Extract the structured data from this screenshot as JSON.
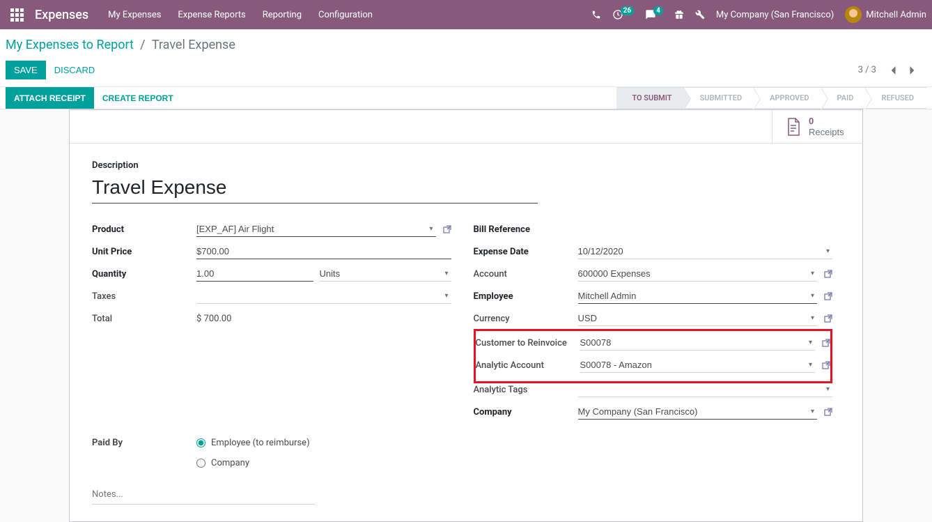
{
  "brand": {
    "app_title": "Expenses"
  },
  "nav": {
    "items": [
      "My Expenses",
      "Expense Reports",
      "Reporting",
      "Configuration"
    ]
  },
  "nav_right": {
    "activities_count": "26",
    "messages_count": "4",
    "company": "My Company (San Francisco)",
    "user": "Mitchell Admin"
  },
  "breadcrumb": {
    "parent": "My Expenses to Report",
    "current": "Travel Expense"
  },
  "actions": {
    "save": "SAVE",
    "discard": "DISCARD",
    "attach": "ATTACH RECEIPT",
    "create_report": "CREATE REPORT"
  },
  "pager": {
    "text": "3 / 3"
  },
  "status": {
    "steps": [
      "TO SUBMIT",
      "SUBMITTED",
      "APPROVED",
      "PAID",
      "REFUSED"
    ],
    "active_index": 0
  },
  "stat": {
    "count": "0",
    "label": "Receipts"
  },
  "form": {
    "description_label": "Description",
    "description_value": "Travel Expense",
    "labels": {
      "product": "Product",
      "unit_price": "Unit Price",
      "quantity": "Quantity",
      "taxes": "Taxes",
      "total": "Total",
      "bill_ref": "Bill Reference",
      "expense_date": "Expense Date",
      "account": "Account",
      "employee": "Employee",
      "currency": "Currency",
      "customer_reinvoice": "Customer to Reinvoice",
      "analytic_account": "Analytic Account",
      "analytic_tags": "Analytic Tags",
      "company": "Company",
      "paid_by": "Paid By",
      "notes_placeholder": "Notes..."
    },
    "values": {
      "product": "[EXP_AF] Air Flight",
      "unit_price": "$700.00",
      "quantity": "1.00",
      "uom": "Units",
      "taxes": "",
      "total": "$ 700.00",
      "bill_ref": "",
      "expense_date": "10/12/2020",
      "account": "600000 Expenses",
      "employee": "Mitchell Admin",
      "currency": "USD",
      "customer_reinvoice": "S00078",
      "analytic_account": "S00078 - Amazon",
      "analytic_tags": "",
      "company": "My Company (San Francisco)"
    },
    "paid_by_options": {
      "employee": "Employee (to reimburse)",
      "company": "Company"
    }
  }
}
